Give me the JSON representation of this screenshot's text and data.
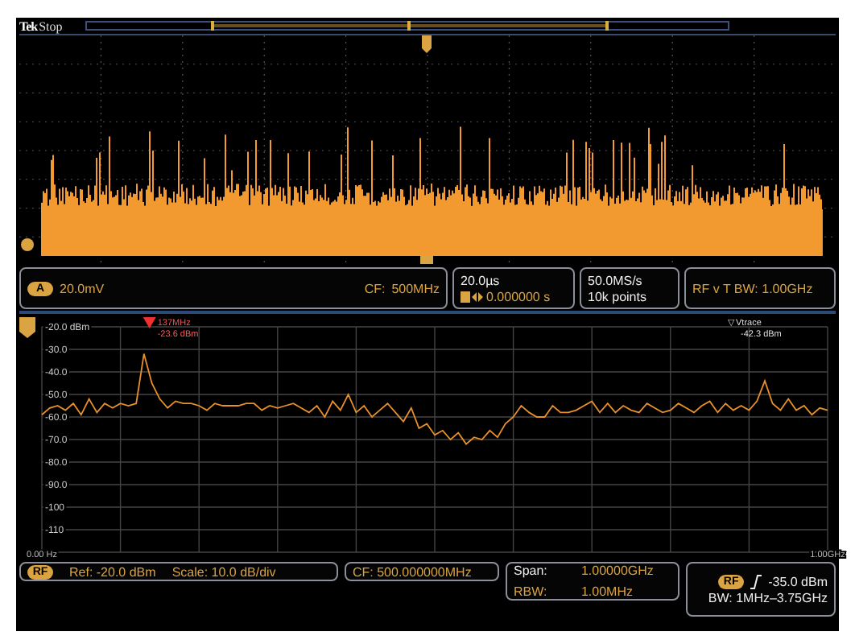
{
  "status": {
    "brand": "Tek",
    "state": "Stop"
  },
  "channel": {
    "badge": "A",
    "scale": "20.0mV",
    "cf_label": "CF:",
    "cf": "500MHz"
  },
  "timebase": {
    "scale": "20.0µs",
    "position": "0.000000 s"
  },
  "acquisition": {
    "rate": "50.0MS/s",
    "length": "10k points"
  },
  "rf_time": {
    "label": "RF v T BW: 1.00GHz"
  },
  "spectrum": {
    "chart_data": {
      "type": "line",
      "grid": true,
      "xlim": [
        0,
        1
      ],
      "ylim": [
        -120,
        -20
      ],
      "yticks": [
        {
          "value": -20,
          "label": "-20.0 dBm"
        },
        {
          "value": -30,
          "label": "-30.0"
        },
        {
          "value": -40,
          "label": "-40.0"
        },
        {
          "value": -50,
          "label": "-50.0"
        },
        {
          "value": -60,
          "label": "-60.0"
        },
        {
          "value": -70,
          "label": "-70.0"
        },
        {
          "value": -80,
          "label": "-80.0"
        },
        {
          "value": -90,
          "label": "-90.0"
        },
        {
          "value": -100,
          "label": "-100"
        },
        {
          "value": -110,
          "label": "-110"
        }
      ],
      "xticks": [
        {
          "value": 0,
          "label": "0.00 Hz"
        },
        {
          "value": 1,
          "label": "1.00GHz"
        }
      ],
      "x": [
        0,
        0.01,
        0.02,
        0.03,
        0.04,
        0.05,
        0.06,
        0.07,
        0.08,
        0.09,
        0.1,
        0.11,
        0.12,
        0.13,
        0.14,
        0.15,
        0.16,
        0.17,
        0.18,
        0.19,
        0.2,
        0.21,
        0.22,
        0.23,
        0.24,
        0.25,
        0.26,
        0.27,
        0.28,
        0.29,
        0.3,
        0.31,
        0.32,
        0.33,
        0.34,
        0.35,
        0.36,
        0.37,
        0.38,
        0.39,
        0.4,
        0.41,
        0.42,
        0.43,
        0.44,
        0.45,
        0.46,
        0.47,
        0.48,
        0.49,
        0.5,
        0.51,
        0.52,
        0.53,
        0.54,
        0.55,
        0.56,
        0.57,
        0.58,
        0.59,
        0.6,
        0.61,
        0.62,
        0.63,
        0.64,
        0.65,
        0.66,
        0.67,
        0.68,
        0.69,
        0.7,
        0.71,
        0.72,
        0.73,
        0.74,
        0.75,
        0.76,
        0.77,
        0.78,
        0.79,
        0.8,
        0.81,
        0.82,
        0.83,
        0.84,
        0.85,
        0.86,
        0.87,
        0.88,
        0.89,
        0.9,
        0.91,
        0.92,
        0.93,
        0.94,
        0.95,
        0.96,
        0.97,
        0.98,
        0.99,
        1
      ],
      "series": [
        {
          "color": "#e8902a",
          "values": [
            -59,
            -56,
            -55,
            -57,
            -54,
            -59,
            -52,
            -58,
            -54,
            -56,
            -54,
            -55,
            -54,
            -32,
            -45,
            -52,
            -56,
            -53,
            -54,
            -54,
            -55,
            -57,
            -54,
            -55,
            -55,
            -55,
            -54,
            -54,
            -57,
            -55,
            -56,
            -55,
            -54,
            -56,
            -58,
            -55,
            -60,
            -53,
            -57,
            -50,
            -58,
            -55,
            -60,
            -57,
            -54,
            -58,
            -62,
            -56,
            -65,
            -63,
            -68,
            -66,
            -70,
            -67,
            -72,
            -69,
            -70,
            -66,
            -69,
            -63,
            -60,
            -55,
            -58,
            -60,
            -60,
            -55,
            -58,
            -58,
            -57,
            -55,
            -53,
            -58,
            -54,
            -58,
            -55,
            -57,
            -58,
            -54,
            -56,
            -58,
            -57,
            -54,
            -56,
            -58,
            -55,
            -53,
            -58,
            -54,
            -57,
            -55,
            -57,
            -53,
            -44,
            -54,
            -57,
            -52,
            -57,
            -55,
            -59,
            -56,
            -57
          ]
        }
      ]
    },
    "marker": {
      "freq": "137MHz",
      "level": "-23.6 dBm"
    },
    "ref_marker": {
      "label": "▽Vtrace",
      "level": "-42.3 dBm"
    }
  },
  "spectrum_settings": {
    "badge": "RF",
    "ref": "Ref: -20.0 dBm",
    "scale": "Scale: 10.0 dB/div",
    "cf": "CF: 500.000000MHz",
    "span_label": "Span:",
    "span": "1.00000GHz",
    "rbw_label": "RBW:",
    "rbw": "1.00MHz"
  },
  "trigger": {
    "badge": "RF",
    "level": "-35.0 dBm",
    "bandwidth": "BW: 1MHz–3.75GHz"
  }
}
